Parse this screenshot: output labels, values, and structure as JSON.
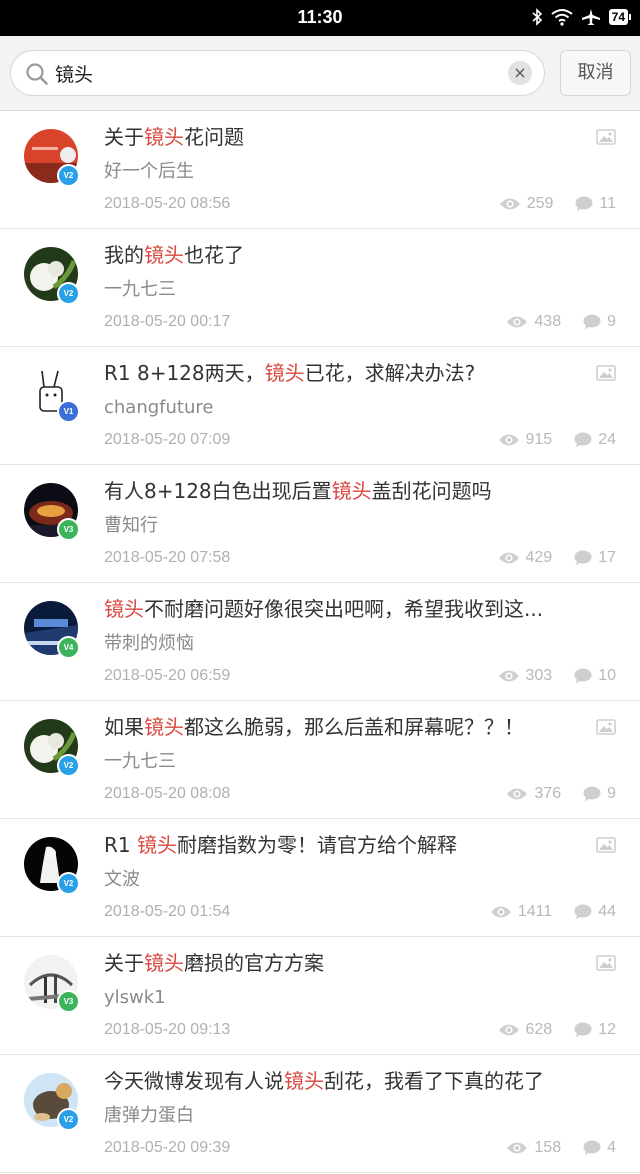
{
  "status_bar": {
    "time": "11:30",
    "battery": "74"
  },
  "search": {
    "query": "镜头",
    "cancel_label": "取消"
  },
  "posts": [
    {
      "title_before": "关于",
      "keyword": "镜头",
      "title_after": "花问题",
      "author": "好一个后生",
      "date": "2018-05-20 08:56",
      "views": "259",
      "comments": "11",
      "has_image": true,
      "level": "V2",
      "badge_color": "#2aa0e8"
    },
    {
      "title_before": "我的",
      "keyword": "镜头",
      "title_after": "也花了",
      "author": "一九七三",
      "date": "2018-05-20 00:17",
      "views": "438",
      "comments": "9",
      "has_image": false,
      "level": "V2",
      "badge_color": "#2aa0e8"
    },
    {
      "title_before": "R1 8+128两天，",
      "keyword": "镜头",
      "title_after": "已花，求解决办法?",
      "author": "changfuture",
      "date": "2018-05-20 07:09",
      "views": "915",
      "comments": "24",
      "has_image": true,
      "level": "V1",
      "badge_color": "#3b6fd8"
    },
    {
      "title_before": "有人8+128白色出现后置",
      "keyword": "镜头",
      "title_after": "盖刮花问题吗",
      "author": "曹知行",
      "date": "2018-05-20 07:58",
      "views": "429",
      "comments": "17",
      "has_image": false,
      "level": "V3",
      "badge_color": "#3cb45a"
    },
    {
      "title_before": "",
      "keyword": "镜头",
      "title_after": "不耐磨问题好像很突出吧啊，希望我收到这...",
      "author": "带刺的烦恼",
      "date": "2018-05-20 06:59",
      "views": "303",
      "comments": "10",
      "has_image": false,
      "level": "V4",
      "badge_color": "#3cb45a"
    },
    {
      "title_before": "如果",
      "keyword": "镜头",
      "title_after": "都这么脆弱，那么后盖和屏幕呢？？！",
      "author": "一九七三",
      "date": "2018-05-20 08:08",
      "views": "376",
      "comments": "9",
      "has_image": true,
      "level": "V2",
      "badge_color": "#2aa0e8"
    },
    {
      "title_before": "R1 ",
      "keyword": "镜头",
      "title_after": "耐磨指数为零！请官方给个解释",
      "author": "文波",
      "date": "2018-05-20 01:54",
      "views": "1411",
      "comments": "44",
      "has_image": true,
      "level": "V2",
      "badge_color": "#2aa0e8"
    },
    {
      "title_before": "关于",
      "keyword": "镜头",
      "title_after": "磨损的官方方案",
      "author": "ylswk1",
      "date": "2018-05-20 09:13",
      "views": "628",
      "comments": "12",
      "has_image": true,
      "level": "V3",
      "badge_color": "#3cb45a"
    },
    {
      "title_before": "今天微博发现有人说",
      "keyword": "镜头",
      "title_after": "刮花，我看了下真的花了",
      "author": "唐弹力蛋白",
      "date": "2018-05-20 09:39",
      "views": "158",
      "comments": "4",
      "has_image": false,
      "level": "V2",
      "badge_color": "#2aa0e8"
    }
  ]
}
